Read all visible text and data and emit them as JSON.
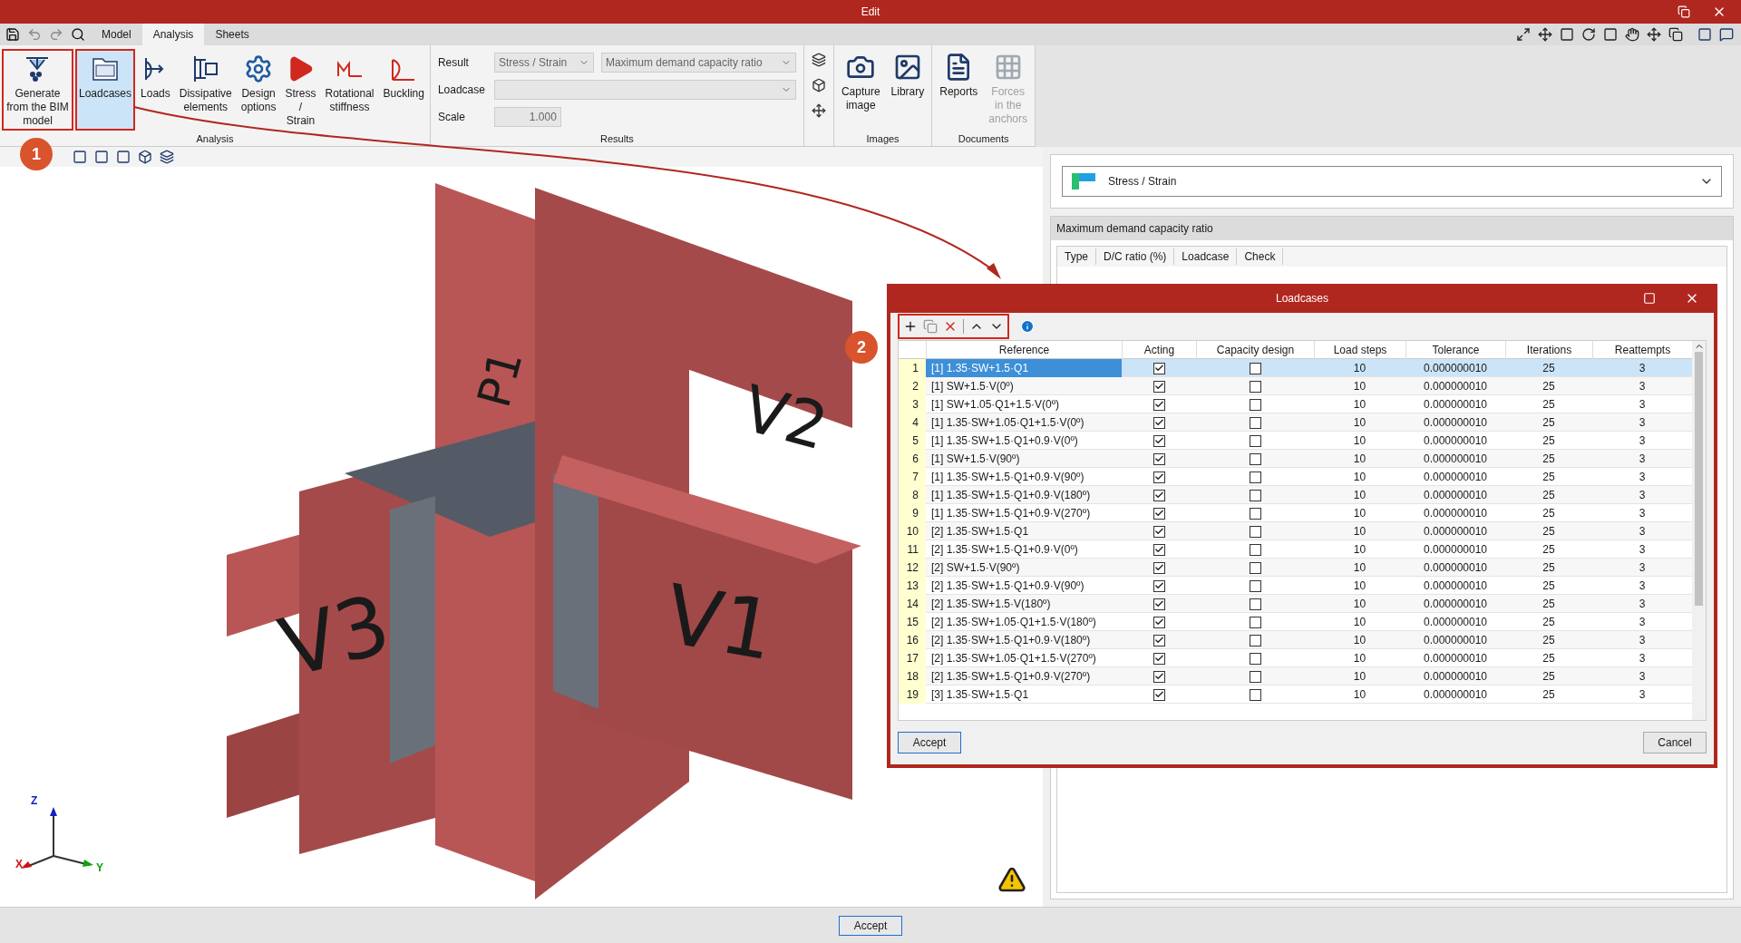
{
  "window": {
    "title": "Edit"
  },
  "tabs": [
    {
      "label": "Model",
      "selected": false
    },
    {
      "label": "Analysis",
      "selected": true
    },
    {
      "label": "Sheets",
      "selected": false
    }
  ],
  "ribbon": {
    "analysis_group": {
      "label": "Analysis",
      "buttons": [
        {
          "kind": "bim",
          "label": "Generate from the BIM model",
          "selected": false,
          "marker": "1"
        },
        {
          "kind": "loadcases",
          "label": "Loadcases",
          "selected": true
        },
        {
          "kind": "loads",
          "label": "Loads",
          "selected": false
        },
        {
          "kind": "dissipative",
          "label": "Dissipative elements",
          "selected": false
        },
        {
          "kind": "design",
          "label": "Design options",
          "selected": false
        },
        {
          "kind": "stress",
          "label": "Stress / Strain",
          "selected": false
        },
        {
          "kind": "rotational",
          "label": "Rotational stiffness",
          "selected": false
        },
        {
          "kind": "buckling",
          "label": "Buckling",
          "selected": false
        }
      ]
    },
    "results_group": {
      "label": "Results",
      "result_label": "Result",
      "result_type": "Stress / Strain",
      "result_value": "Maximum demand capacity ratio",
      "loadcase_label": "Loadcase",
      "scale_label": "Scale",
      "scale_value": "1.000"
    },
    "images_group": {
      "label": "Images",
      "buttons": [
        {
          "kind": "camera",
          "label": "Capture image",
          "disabled": false
        },
        {
          "kind": "library",
          "label": "Library",
          "disabled": false
        }
      ]
    },
    "documents_group": {
      "label": "Documents",
      "buttons": [
        {
          "kind": "reports",
          "label": "Reports",
          "disabled": false
        },
        {
          "kind": "anchors",
          "label": "Forces in the anchors",
          "disabled": true
        }
      ]
    }
  },
  "viewport": {
    "model_labels": [
      {
        "kind": "v1",
        "text": "V1"
      },
      {
        "kind": "v2",
        "text": "V2"
      },
      {
        "kind": "v3",
        "text": "V3"
      },
      {
        "kind": "p1",
        "text": "P1"
      }
    ],
    "axes": {
      "x": "X",
      "y": "Y",
      "z": "Z"
    }
  },
  "right_panel": {
    "result_select": "Stress / Strain",
    "section_title": "Maximum demand capacity ratio",
    "columns": [
      "Type",
      "D/C ratio (%)",
      "Loadcase",
      "Check"
    ]
  },
  "dialog": {
    "title": "Loadcases",
    "marker": "2",
    "columns": [
      "Reference",
      "Acting",
      "Capacity design",
      "Load steps",
      "Tolerance",
      "Iterations",
      "Reattempts"
    ],
    "rows": [
      {
        "index": "1",
        "reference": "[1] 1.35·SW+1.5·Q1",
        "acting": true,
        "capacity_design": false,
        "load_steps": "10",
        "tolerance": "0.000000010",
        "iterations": "25",
        "reattempts": "3",
        "selected": true
      },
      {
        "index": "2",
        "reference": "[1] SW+1.5·V(0º)",
        "acting": true,
        "capacity_design": false,
        "load_steps": "10",
        "tolerance": "0.000000010",
        "iterations": "25",
        "reattempts": "3",
        "selected": false
      },
      {
        "index": "3",
        "reference": "[1] SW+1.05·Q1+1.5·V(0º)",
        "acting": true,
        "capacity_design": false,
        "load_steps": "10",
        "tolerance": "0.000000010",
        "iterations": "25",
        "reattempts": "3",
        "selected": false
      },
      {
        "index": "4",
        "reference": "[1] 1.35·SW+1.05·Q1+1.5·V(0º)",
        "acting": true,
        "capacity_design": false,
        "load_steps": "10",
        "tolerance": "0.000000010",
        "iterations": "25",
        "reattempts": "3",
        "selected": false
      },
      {
        "index": "5",
        "reference": "[1] 1.35·SW+1.5·Q1+0.9·V(0º)",
        "acting": true,
        "capacity_design": false,
        "load_steps": "10",
        "tolerance": "0.000000010",
        "iterations": "25",
        "reattempts": "3",
        "selected": false
      },
      {
        "index": "6",
        "reference": "[1] SW+1.5·V(90º)",
        "acting": true,
        "capacity_design": false,
        "load_steps": "10",
        "tolerance": "0.000000010",
        "iterations": "25",
        "reattempts": "3",
        "selected": false
      },
      {
        "index": "7",
        "reference": "[1] 1.35·SW+1.5·Q1+0.9·V(90º)",
        "acting": true,
        "capacity_design": false,
        "load_steps": "10",
        "tolerance": "0.000000010",
        "iterations": "25",
        "reattempts": "3",
        "selected": false
      },
      {
        "index": "8",
        "reference": "[1] 1.35·SW+1.5·Q1+0.9·V(180º)",
        "acting": true,
        "capacity_design": false,
        "load_steps": "10",
        "tolerance": "0.000000010",
        "iterations": "25",
        "reattempts": "3",
        "selected": false
      },
      {
        "index": "9",
        "reference": "[1] 1.35·SW+1.5·Q1+0.9·V(270º)",
        "acting": true,
        "capacity_design": false,
        "load_steps": "10",
        "tolerance": "0.000000010",
        "iterations": "25",
        "reattempts": "3",
        "selected": false
      },
      {
        "index": "10",
        "reference": "[2] 1.35·SW+1.5·Q1",
        "acting": true,
        "capacity_design": false,
        "load_steps": "10",
        "tolerance": "0.000000010",
        "iterations": "25",
        "reattempts": "3",
        "selected": false
      },
      {
        "index": "11",
        "reference": "[2] 1.35·SW+1.5·Q1+0.9·V(0º)",
        "acting": true,
        "capacity_design": false,
        "load_steps": "10",
        "tolerance": "0.000000010",
        "iterations": "25",
        "reattempts": "3",
        "selected": false
      },
      {
        "index": "12",
        "reference": "[2] SW+1.5·V(90º)",
        "acting": true,
        "capacity_design": false,
        "load_steps": "10",
        "tolerance": "0.000000010",
        "iterations": "25",
        "reattempts": "3",
        "selected": false
      },
      {
        "index": "13",
        "reference": "[2] 1.35·SW+1.5·Q1+0.9·V(90º)",
        "acting": true,
        "capacity_design": false,
        "load_steps": "10",
        "tolerance": "0.000000010",
        "iterations": "25",
        "reattempts": "3",
        "selected": false
      },
      {
        "index": "14",
        "reference": "[2] 1.35·SW+1.5·V(180º)",
        "acting": true,
        "capacity_design": false,
        "load_steps": "10",
        "tolerance": "0.000000010",
        "iterations": "25",
        "reattempts": "3",
        "selected": false
      },
      {
        "index": "15",
        "reference": "[2] 1.35·SW+1.05·Q1+1.5·V(180º)",
        "acting": true,
        "capacity_design": false,
        "load_steps": "10",
        "tolerance": "0.000000010",
        "iterations": "25",
        "reattempts": "3",
        "selected": false
      },
      {
        "index": "16",
        "reference": "[2] 1.35·SW+1.5·Q1+0.9·V(180º)",
        "acting": true,
        "capacity_design": false,
        "load_steps": "10",
        "tolerance": "0.000000010",
        "iterations": "25",
        "reattempts": "3",
        "selected": false
      },
      {
        "index": "17",
        "reference": "[2] 1.35·SW+1.05·Q1+1.5·V(270º)",
        "acting": true,
        "capacity_design": false,
        "load_steps": "10",
        "tolerance": "0.000000010",
        "iterations": "25",
        "reattempts": "3",
        "selected": false
      },
      {
        "index": "18",
        "reference": "[2] 1.35·SW+1.5·Q1+0.9·V(270º)",
        "acting": true,
        "capacity_design": false,
        "load_steps": "10",
        "tolerance": "0.000000010",
        "iterations": "25",
        "reattempts": "3",
        "selected": false
      },
      {
        "index": "19",
        "reference": "[3] 1.35·SW+1.5·Q1",
        "acting": true,
        "capacity_design": false,
        "load_steps": "10",
        "tolerance": "0.000000010",
        "iterations": "25",
        "reattempts": "3",
        "selected": false
      }
    ],
    "buttons": [
      "Accept",
      "Cancel"
    ]
  },
  "footer": {
    "button": "Accept"
  }
}
